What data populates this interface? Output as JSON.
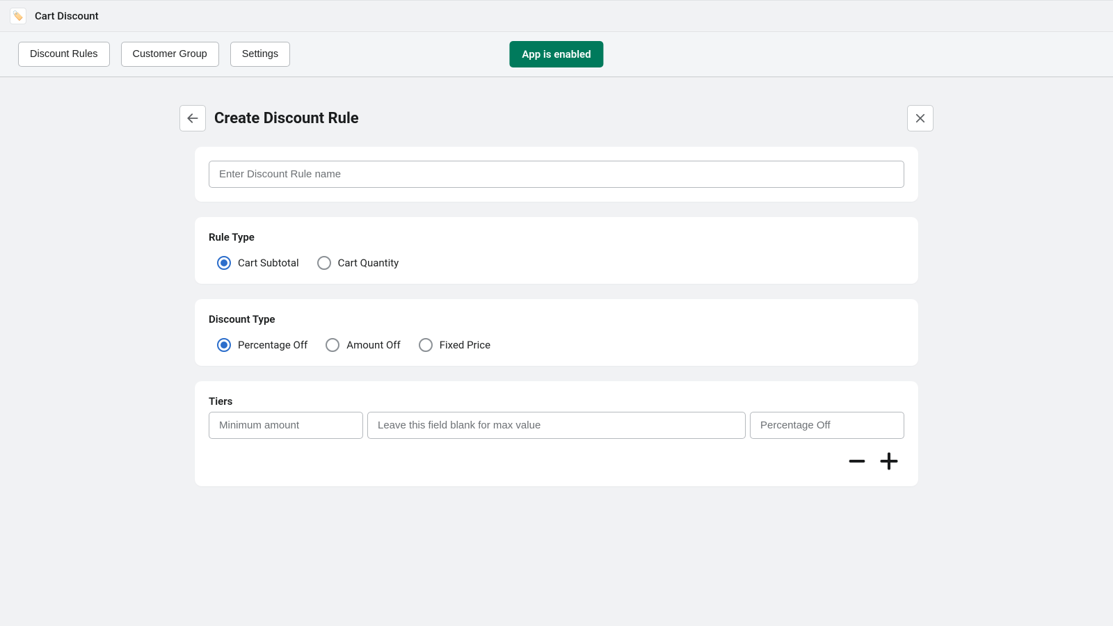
{
  "app": {
    "title": "Cart Discount",
    "icon": "🏷️"
  },
  "nav": {
    "tabs": [
      {
        "label": "Discount Rules"
      },
      {
        "label": "Customer Group"
      },
      {
        "label": "Settings"
      }
    ],
    "status": "App is enabled"
  },
  "page": {
    "title": "Create Discount Rule"
  },
  "form": {
    "name_placeholder": "Enter Discount Rule name",
    "rule_type": {
      "label": "Rule Type",
      "options": [
        {
          "label": "Cart Subtotal",
          "selected": true
        },
        {
          "label": "Cart Quantity",
          "selected": false
        }
      ]
    },
    "discount_type": {
      "label": "Discount Type",
      "options": [
        {
          "label": "Percentage Off",
          "selected": true
        },
        {
          "label": "Amount Off",
          "selected": false
        },
        {
          "label": "Fixed Price",
          "selected": false
        }
      ]
    },
    "tiers": {
      "label": "Tiers",
      "min_placeholder": "Minimum amount",
      "max_placeholder": "Leave this field blank for max value",
      "pct_placeholder": "Percentage Off"
    }
  }
}
